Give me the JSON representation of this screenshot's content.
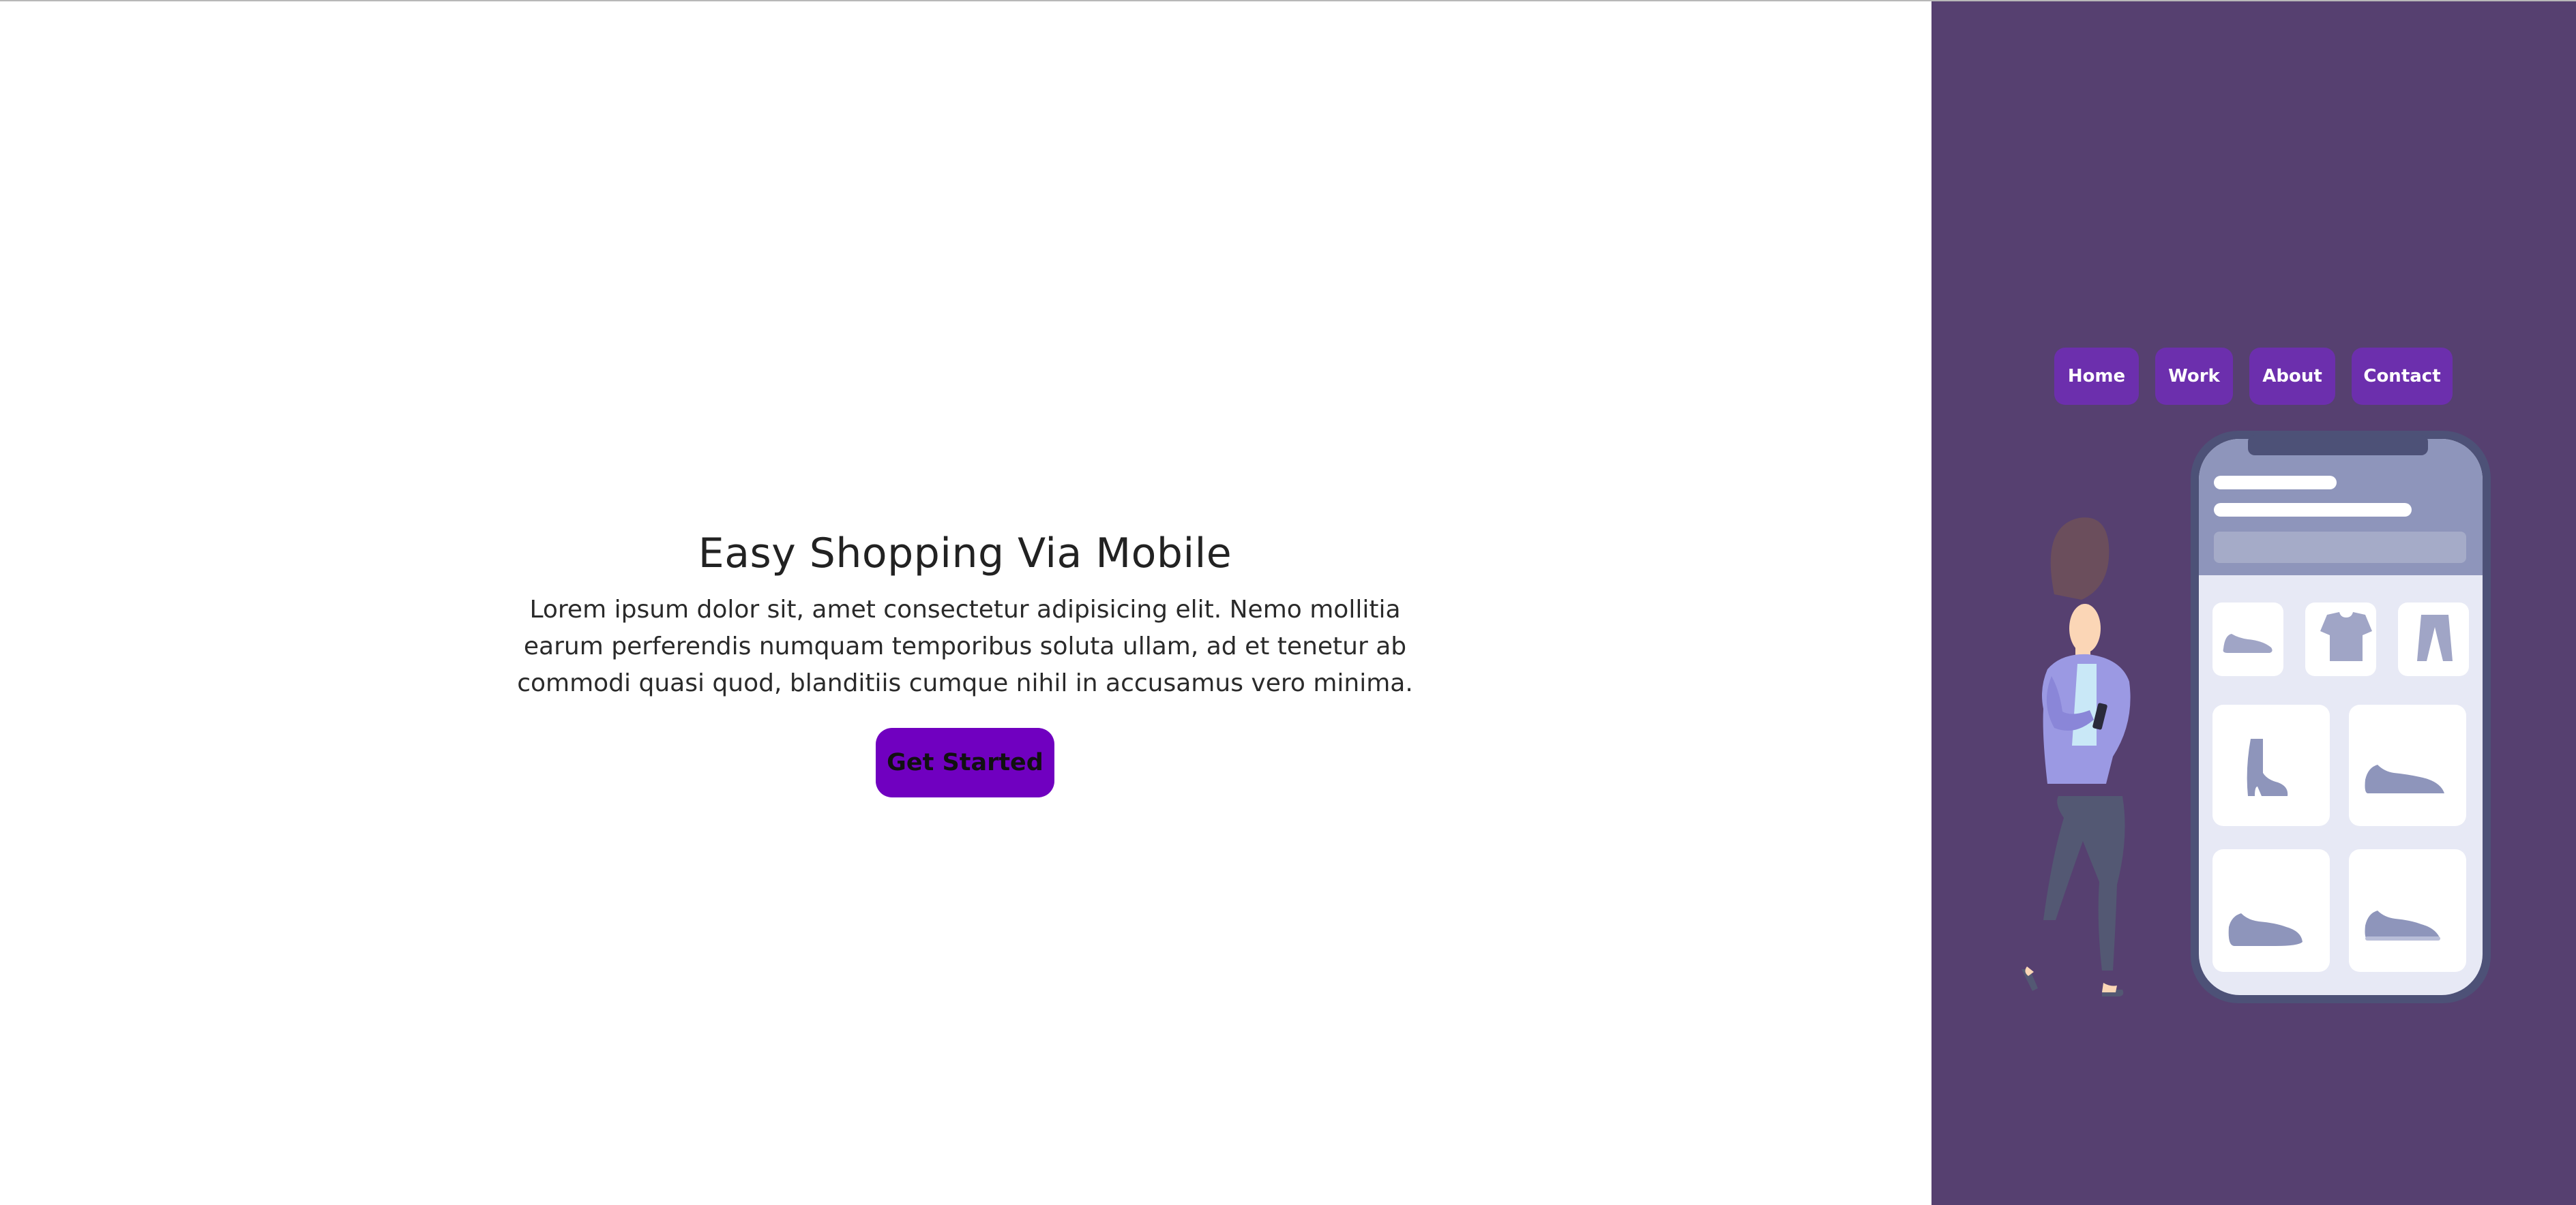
{
  "hero": {
    "title": "Easy Shopping Via Mobile",
    "body_line1": "Lorem ipsum dolor sit, amet consectetur adipisicing elit. Nemo mollitia",
    "body_line2": "earum perferendis numquam temporibus soluta ullam, ad et tenetur ab",
    "body_line3": "commodi quasi quod, blanditiis cumque nihil in accusamus vero minima.",
    "cta_label": "Get Started"
  },
  "nav": {
    "items": [
      {
        "label": "Home"
      },
      {
        "label": "Work"
      },
      {
        "label": "About"
      },
      {
        "label": "Contact"
      }
    ]
  },
  "colors": {
    "left_bg": "#ffffff",
    "right_bg": "#564070",
    "nav_button": "#6c2fad",
    "cta_button": "#7000c0"
  },
  "illustration": {
    "subject": "woman-holding-phone-icon",
    "phone": "shopping-app-phone-icon",
    "products": [
      "sneaker-icon",
      "tshirt-icon",
      "pants-icon",
      "boot-icon",
      "sneaker-icon",
      "sneaker-icon",
      "sneaker-icon"
    ]
  }
}
